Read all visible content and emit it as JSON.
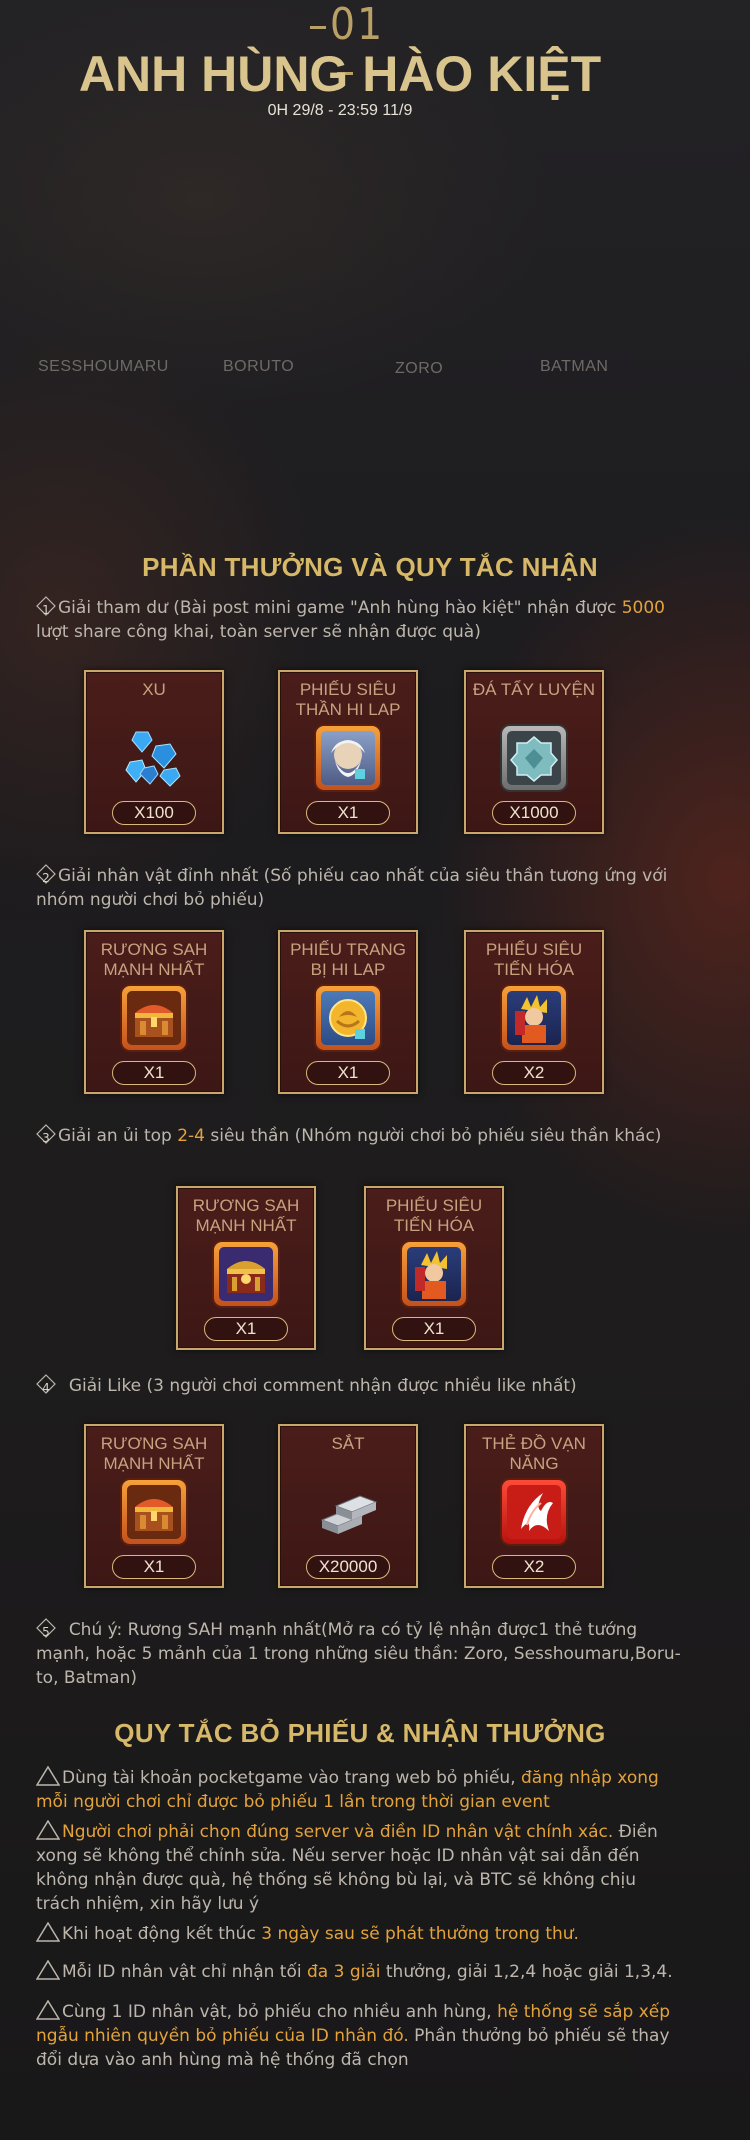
{
  "header": {
    "number": "01",
    "title": "ANH HÙNG HÀO KIỆT",
    "date": "0H 29/8 - 23:59 11/9"
  },
  "heroes": [
    "SESSHOUMARU",
    "BORUTO",
    "ZORO",
    "BATMAN"
  ],
  "rewards": {
    "title": "PHẦN THƯỞNG VÀ QUY TẮC NHẬN",
    "sections": [
      {
        "num": "1",
        "text_a": "Giải tham dư (Bài post mini game \"Anh hùng hào kiệt\" nhận được ",
        "text_hl": "5000",
        "text_b": "lượt share công khai, toàn server sẽ nhận được quà)",
        "items": [
          {
            "name": "XU",
            "qty": "X100",
            "icon": "diamond-icon"
          },
          {
            "name": "PHIẾU SIÊU THẦN HI LAP",
            "qty": "X1",
            "icon": "zeus-ticket-icon"
          },
          {
            "name": "ĐÁ TẨY LUYỆN",
            "qty": "X1000",
            "icon": "refining-stone-icon"
          }
        ]
      },
      {
        "num": "2",
        "text_a": "Giải nhân vật đỉnh nhất (Số phiếu cao nhất của siêu thần tương ứng với",
        "text_b": "nhóm người chơi bỏ phiếu)",
        "items": [
          {
            "name": "RƯƠNG SAH MẠNH NHẤT",
            "qty": "X1",
            "icon": "chest-icon"
          },
          {
            "name": "PHIẾU TRANG BỊ HI LAP",
            "qty": "X1",
            "icon": "equipment-ticket-icon"
          },
          {
            "name": "PHIẾU SIÊU TIẾN HÓA",
            "qty": "X2",
            "icon": "evolution-ticket-icon"
          }
        ]
      },
      {
        "num": "3",
        "text_a": "Giải an ủi top ",
        "text_hl": "2-4",
        "text_b": " siêu thần (Nhóm người chơi bỏ phiếu siêu thần khác)",
        "items": [
          {
            "name": "RƯƠNG SAH MẠNH NHẤT",
            "qty": "X1",
            "icon": "chest-icon"
          },
          {
            "name": "PHIẾU SIÊU TIẾN HÓA",
            "qty": "X1",
            "icon": "evolution-ticket-icon"
          }
        ]
      },
      {
        "num": "4",
        "text_a": "Giải Like (3 người chơi comment nhận được nhiều like nhất)",
        "items": [
          {
            "name": "RƯƠNG SAH MẠNH NHẤT",
            "qty": "X1",
            "icon": "chest-icon"
          },
          {
            "name": "SẮT",
            "qty": "X20000",
            "icon": "iron-icon"
          },
          {
            "name": "THẺ ĐỒ VẠN NĂNG",
            "qty": "X2",
            "icon": "universal-card-icon"
          }
        ]
      },
      {
        "num": "5",
        "text_a": "Chú ý: Rương SAH mạnh nhất(Mở ra  có tỷ lệ nhận được1 thẻ tướng",
        "text_b": "mạnh, hoặc 5 mảnh của 1 trong những siêu thần: Zoro, Sesshoumaru,Boru-",
        "text_c": "to, Batman)"
      }
    ]
  },
  "rules": {
    "title": "QUY TẮC BỎ PHIẾU & NHẬN THƯỞNG",
    "r1_a": "Dùng tài khoản pocketgame vào trang web bỏ phiếu, ",
    "r1_hl_a": "đăng nhập xong",
    "r1_hl_b": "mỗi người chơi chỉ được bỏ phiếu 1 lần trong thời gian event",
    "r2_hl": "Người chơi phải chọn đúng server và điền ID nhân vật chính xác.",
    "r2_a": " Điền",
    "r2_b": "xong sẽ không thể chỉnh sửa. Nếu server hoặc ID nhân vật sai dẫn đến",
    "r2_c": "không nhận được quà, hệ thống sẽ không bù lại, và BTC sẽ không chịu",
    "r2_d": "trách nhiệm, xin hãy lưu ý",
    "r3_a": "Khi hoạt động kết thúc ",
    "r3_hl": "3 ngày sau sẽ phát thưởng trong thư.",
    "r4_a": "Mỗi ID nhân vật chỉ nhận tối ",
    "r4_hl": "đa 3 giải",
    "r4_b": " thưởng, giải 1,2,4 hoặc giải 1,3,4.",
    "r5_a": "Cùng 1 ID nhân vật, bỏ phiếu cho nhiều anh hùng, ",
    "r5_hl_a": "hệ thống sẽ sắp xếp",
    "r5_hl_b": "ngẫu nhiên quyền bỏ phiếu của ID nhân đó.",
    "r5_b": " Phần thưởng bỏ phiếu sẽ thay",
    "r5_c": "đổi dựa vào anh hùng mà hệ thống đã chọn"
  },
  "colors": {
    "gold": "#d6b868",
    "highlight": "#e3a33a",
    "card_bg": "#4a1d1a",
    "card_border": "#c9a66a"
  }
}
